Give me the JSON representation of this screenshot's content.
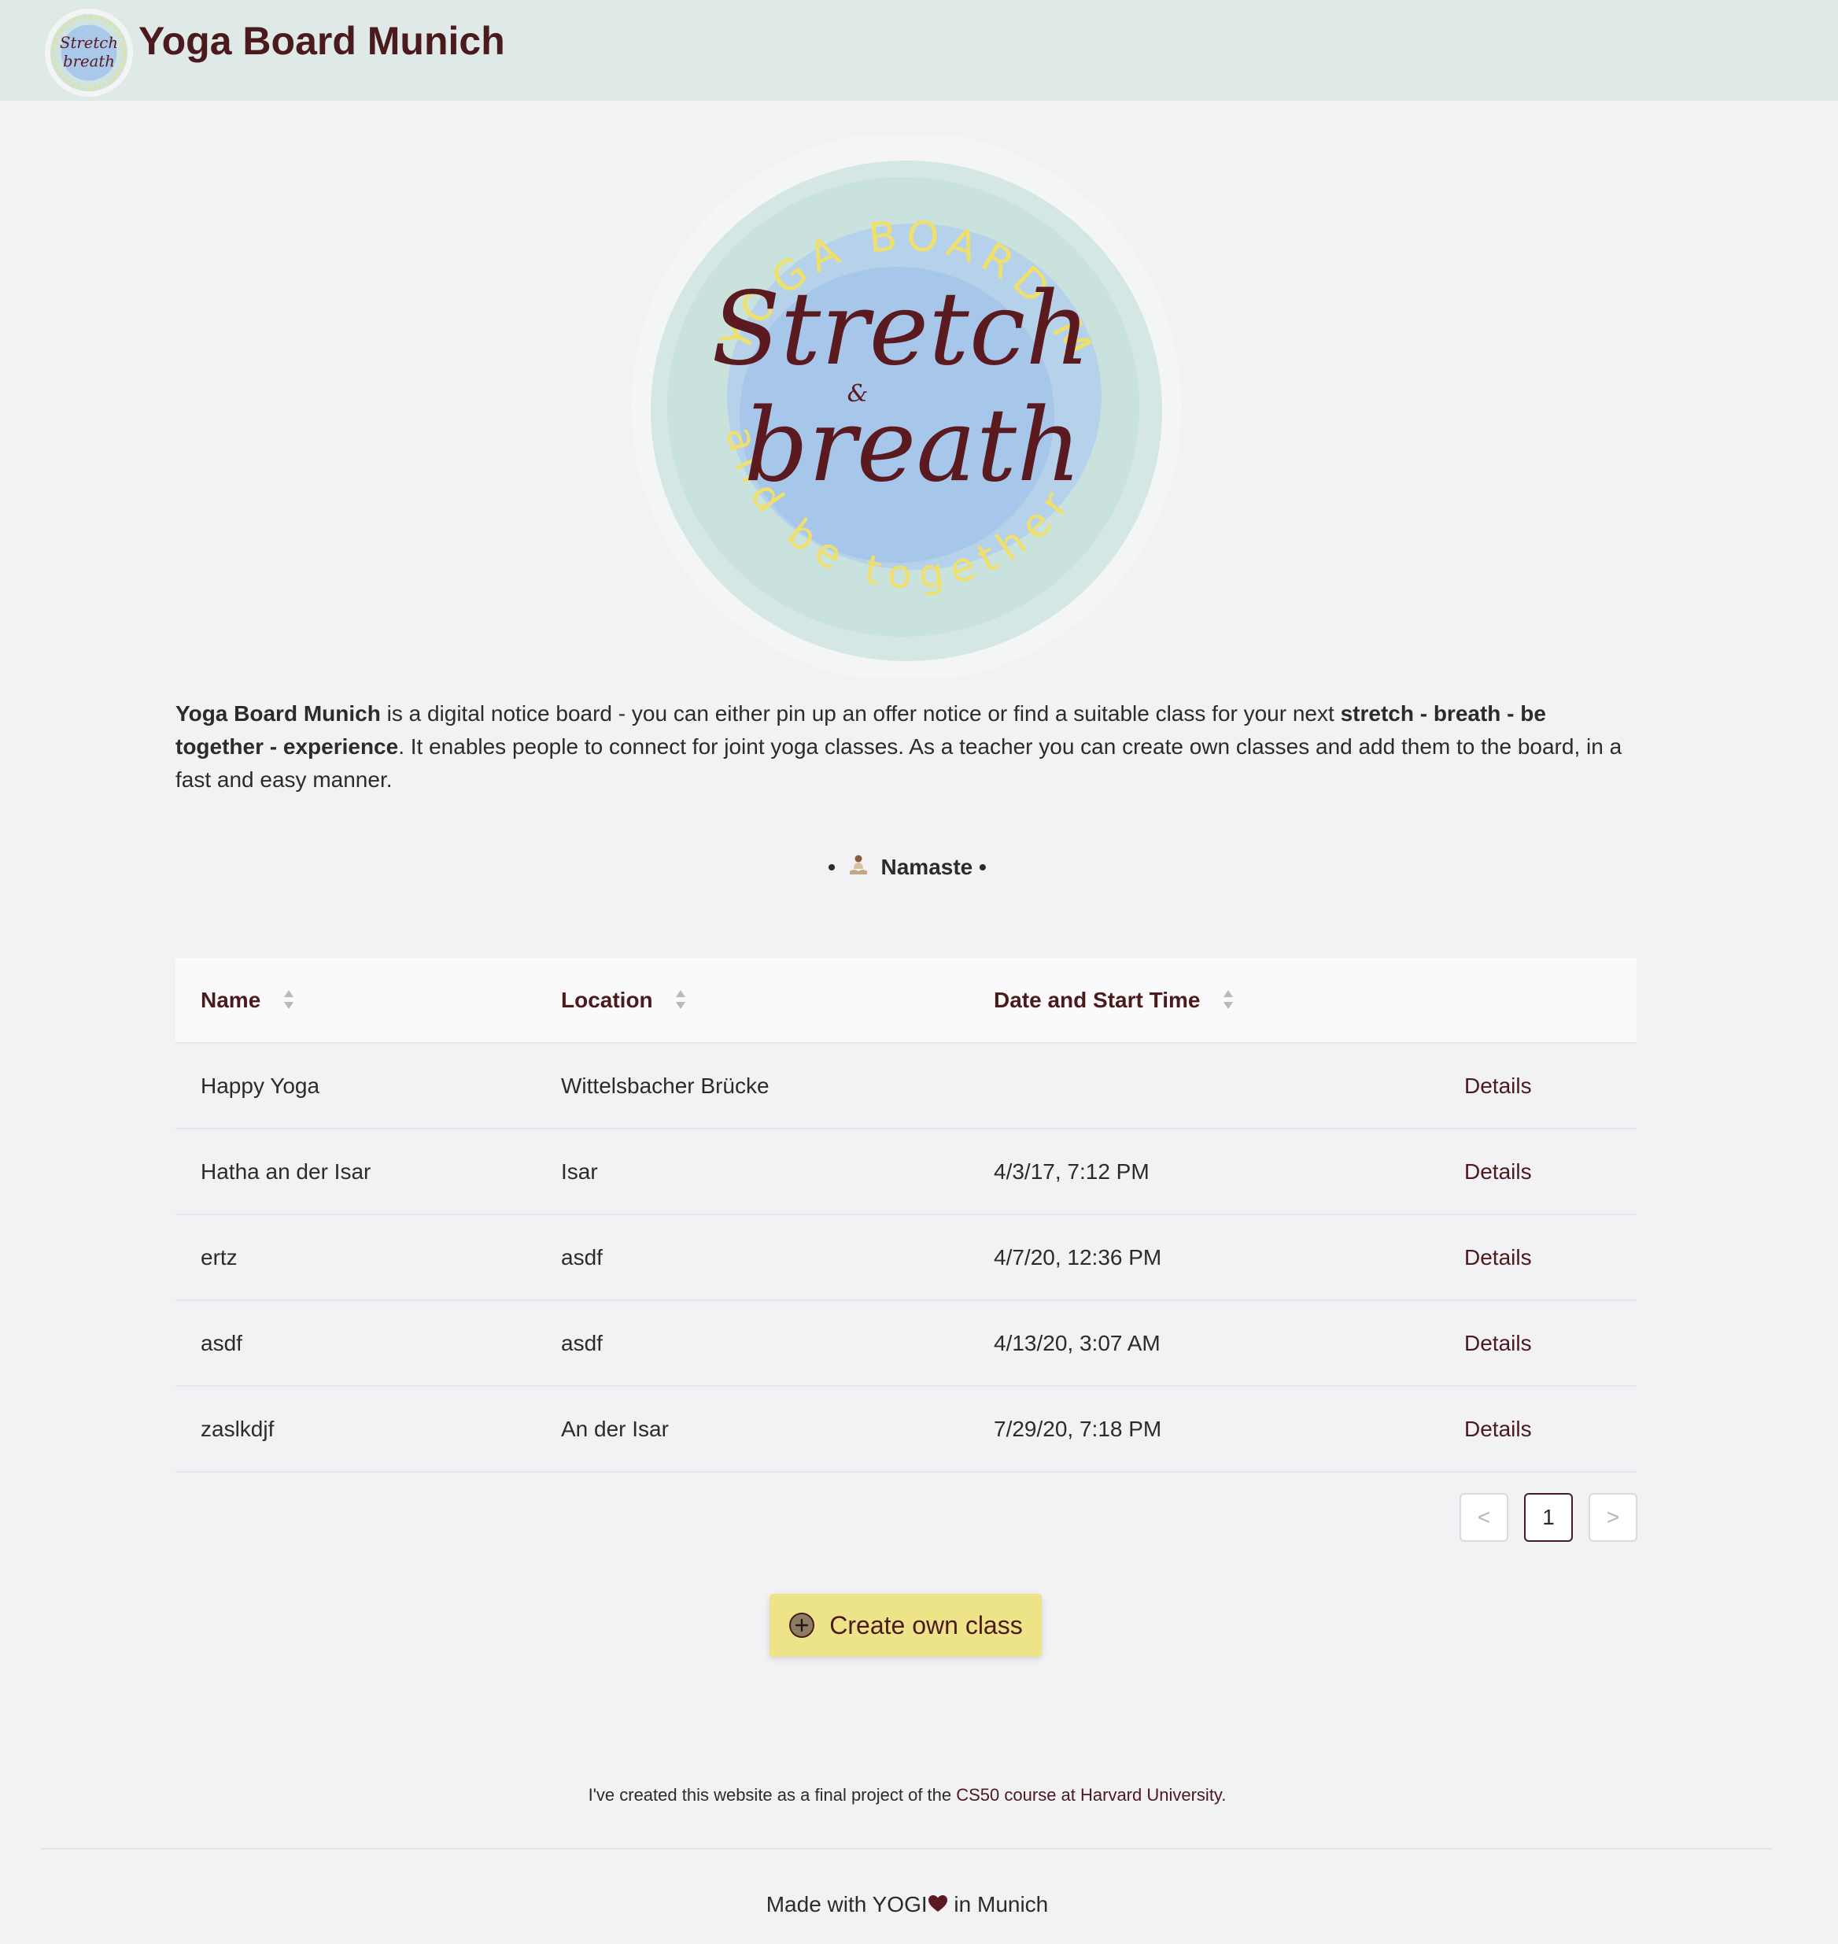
{
  "header": {
    "title": "Yoga Board Munich",
    "logo_icon": "stretch-and-breath-logo-icon"
  },
  "hero": {
    "logo_icon": "stretch-and-breath-logo-icon",
    "logo_text_main_1": "Stretch",
    "logo_text_amp": "&",
    "logo_text_main_2": "breath",
    "logo_arc_top": "YOGA BOARD MUC",
    "logo_arc_bottom": "and be together"
  },
  "intro": {
    "brand": "Yoga Board Munich",
    "text_1": " is a digital notice board - you can either pin up an offer notice or find a suitable class for your next ",
    "emphasis": "stretch - breath - be together - experience",
    "text_2": ". It enables people to connect for joint yoga classes. As a teacher you can create own classes and add them to the board, in a fast and easy manner."
  },
  "namaste": {
    "bullet_left": "•",
    "label": "Namaste",
    "bullet_right": "•",
    "icon": "meditation-icon"
  },
  "table": {
    "columns": [
      {
        "label": "Name",
        "sort_icon": "sort-icon"
      },
      {
        "label": "Location",
        "sort_icon": "sort-icon"
      },
      {
        "label": "Date and Start Time",
        "sort_icon": "sort-icon"
      }
    ],
    "rows": [
      {
        "name": "Happy Yoga",
        "location": "Wittelsbacher Brücke",
        "date": "",
        "action": "Details"
      },
      {
        "name": "Hatha an der Isar",
        "location": "Isar",
        "date": "4/3/17, 7:12 PM",
        "action": "Details"
      },
      {
        "name": "ertz",
        "location": "asdf",
        "date": "4/7/20, 12:36 PM",
        "action": "Details"
      },
      {
        "name": "asdf",
        "location": "asdf",
        "date": "4/13/20, 3:07 AM",
        "action": "Details"
      },
      {
        "name": "zaslkdjf",
        "location": "An der Isar",
        "date": "7/29/20, 7:18 PM",
        "action": "Details"
      }
    ]
  },
  "pagination": {
    "prev": "<",
    "current_page": "1",
    "next": ">"
  },
  "create_button": {
    "label": "Create own class",
    "icon": "plus-circle-icon"
  },
  "footer": {
    "credit_prefix": "I've created this website as a final project of the ",
    "credit_link": "CS50 course at Harvard University",
    "credit_suffix": ".",
    "made_with_prefix": "Made with YOGI",
    "heart_icon": "heart-icon",
    "made_with_suffix": " in Munich"
  },
  "colors": {
    "brand": "#4a1a1d",
    "header_bg": "#dfe9e8",
    "page_bg": "#f2f2f5",
    "accent_button": "#ede48a",
    "logo_yellow": "#f0e06a",
    "logo_blue": "#9ec1e6"
  }
}
